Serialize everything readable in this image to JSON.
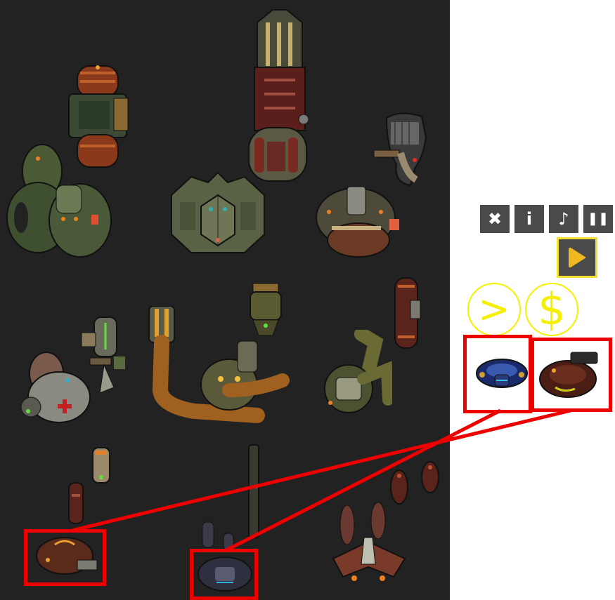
{
  "controls": {
    "close": {
      "icon": "close-icon",
      "glyph": "✖"
    },
    "info": {
      "icon": "info-icon",
      "glyph": "i"
    },
    "music": {
      "icon": "music-note-icon",
      "glyph": "♪"
    },
    "pause": {
      "icon": "pause-icon",
      "glyph": "❚❚"
    },
    "play": {
      "icon": "play-icon"
    }
  },
  "action_circles": {
    "next": {
      "label": ">"
    },
    "shop": {
      "label": "$"
    }
  },
  "palette": {
    "board_background": "#222222",
    "highlight_red": "#ee0000",
    "accent_yellow": "#f4f000",
    "button_gray": "#4a4a4a"
  },
  "pieces_on_board": [
    "orange-capsule-robot",
    "long-crimson-cannon-robot",
    "grey-claw-robot",
    "green-turret-robot",
    "green-hexagon-mech",
    "bronze-dome-mech",
    "small-olive-pod",
    "rust-capsule-robot",
    "green-scope-gun",
    "medic-robot",
    "copper-arm-mech",
    "olive-arm-robot",
    "small-tan-pod",
    "dark-red-bot",
    "antenna-pole",
    "red-drone-pair",
    "brown-saucer-robot",
    "navy-drone-robot",
    "red-spider-drone"
  ],
  "selections": [
    {
      "name": "blue-ship-selection",
      "piece": "navy-drone-robot"
    },
    {
      "name": "brown-ship-selection",
      "piece": "brown-saucer-robot"
    }
  ]
}
